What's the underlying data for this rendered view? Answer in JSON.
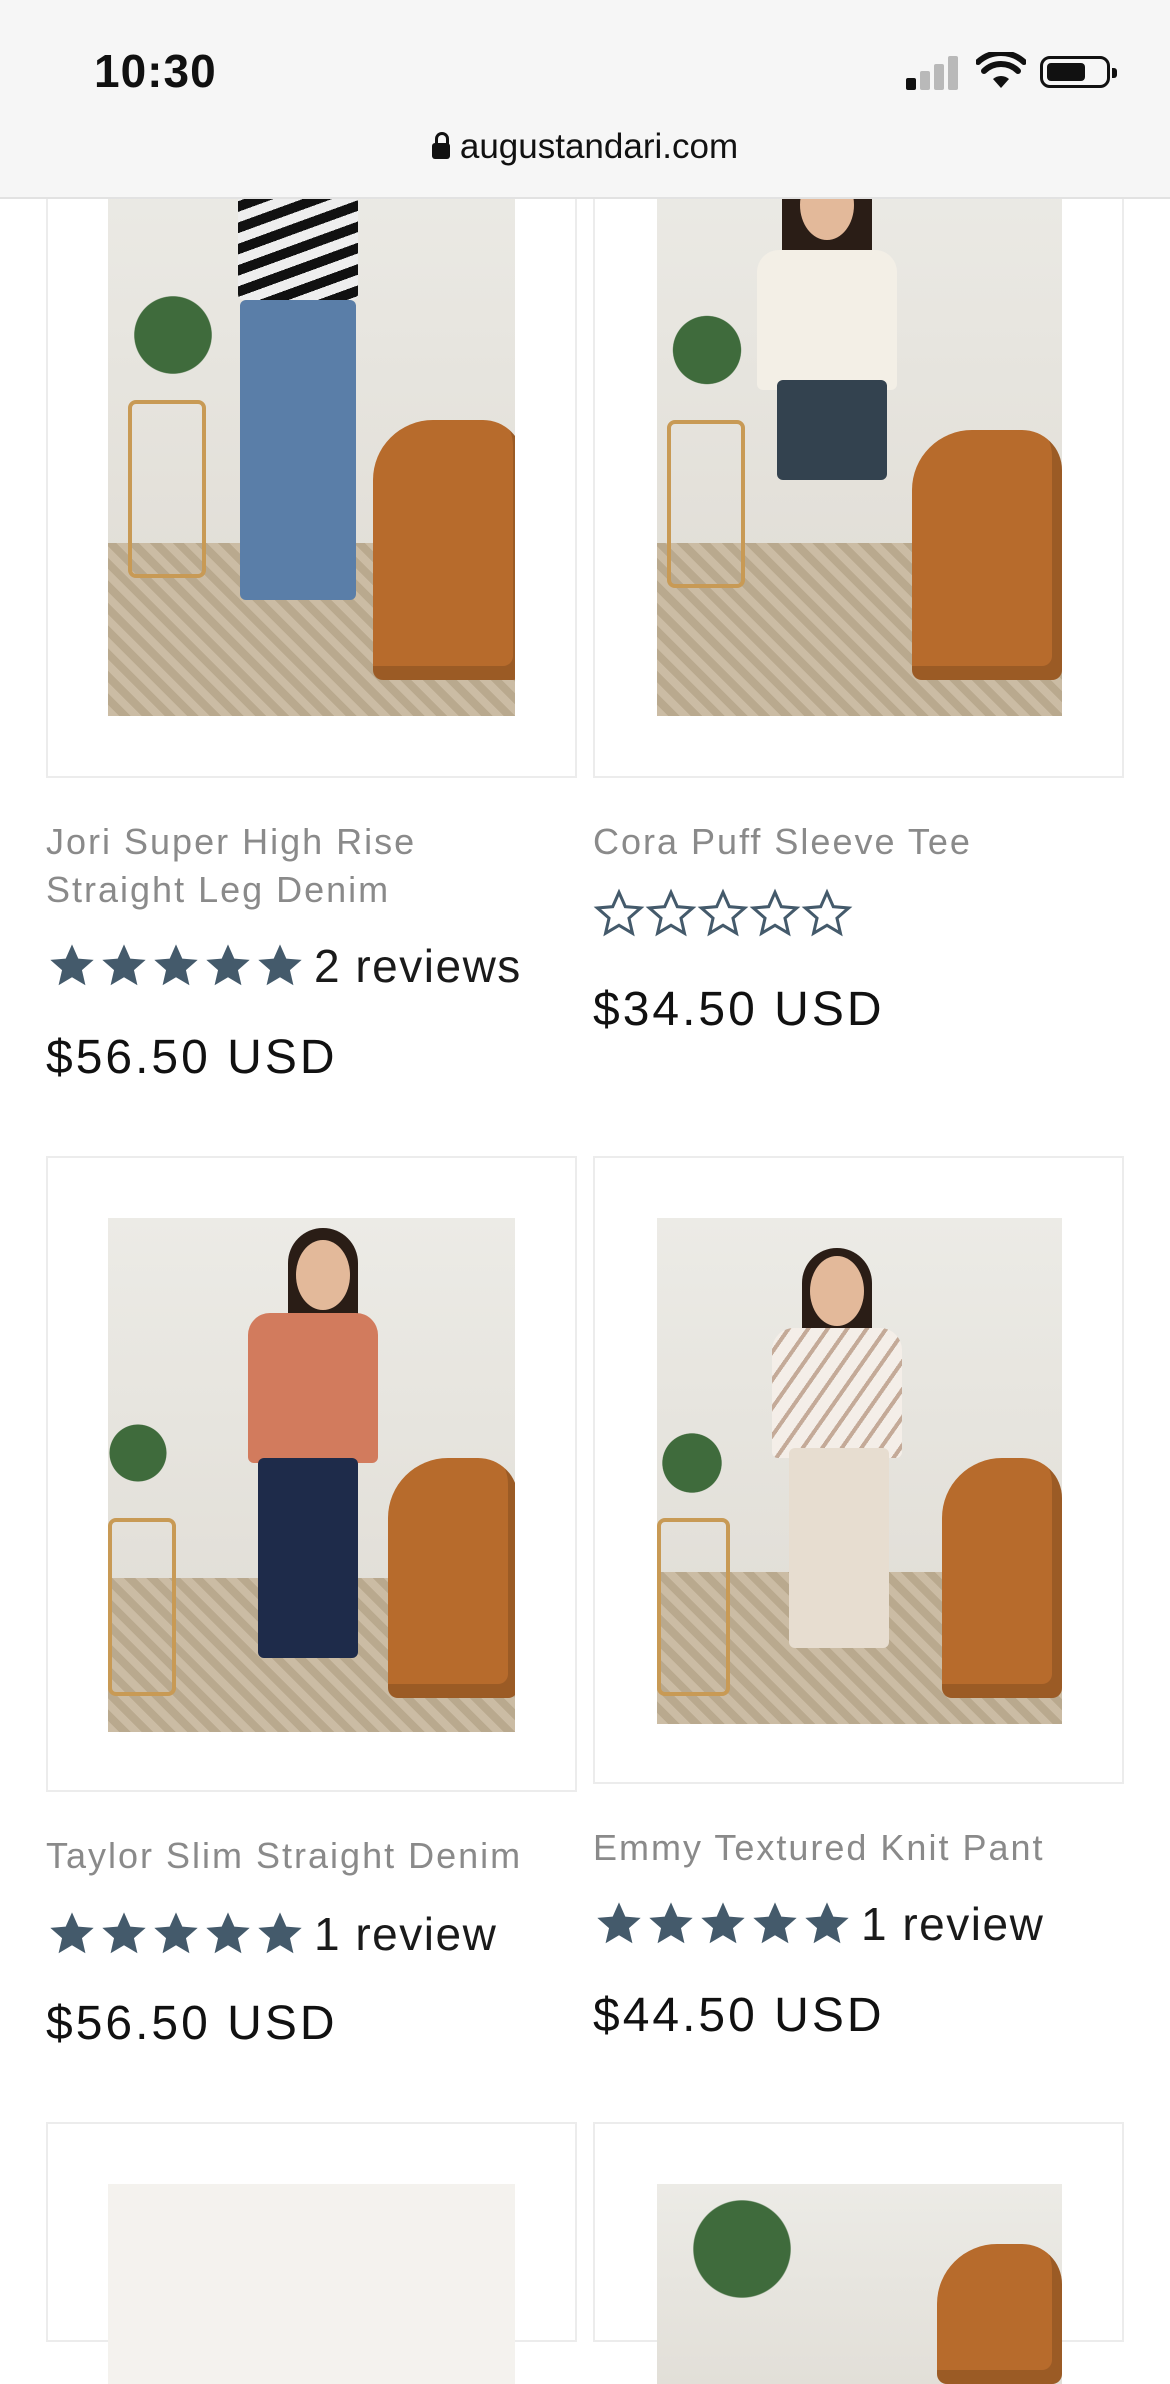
{
  "status_bar": {
    "time": "10:30"
  },
  "address_bar": {
    "url": "augustandari.com"
  },
  "products": [
    {
      "title": "Jori Super High Rise Straight Leg Denim",
      "rating": 5,
      "reviews": "2 reviews",
      "price": "$56.50 USD"
    },
    {
      "title": "Cora Puff Sleeve Tee",
      "rating": 0,
      "reviews": "",
      "price": "$34.50 USD"
    },
    {
      "title": "Taylor Slim Straight Denim",
      "rating": 5,
      "reviews": "1 review",
      "price": "$56.50 USD"
    },
    {
      "title": "Emmy Textured Knit Pant",
      "rating": 5,
      "reviews": "1 review",
      "price": "$44.50 USD"
    }
  ],
  "colors": {
    "star": "#445a6b",
    "chair": "#b76b2c",
    "border": "#ececec"
  }
}
